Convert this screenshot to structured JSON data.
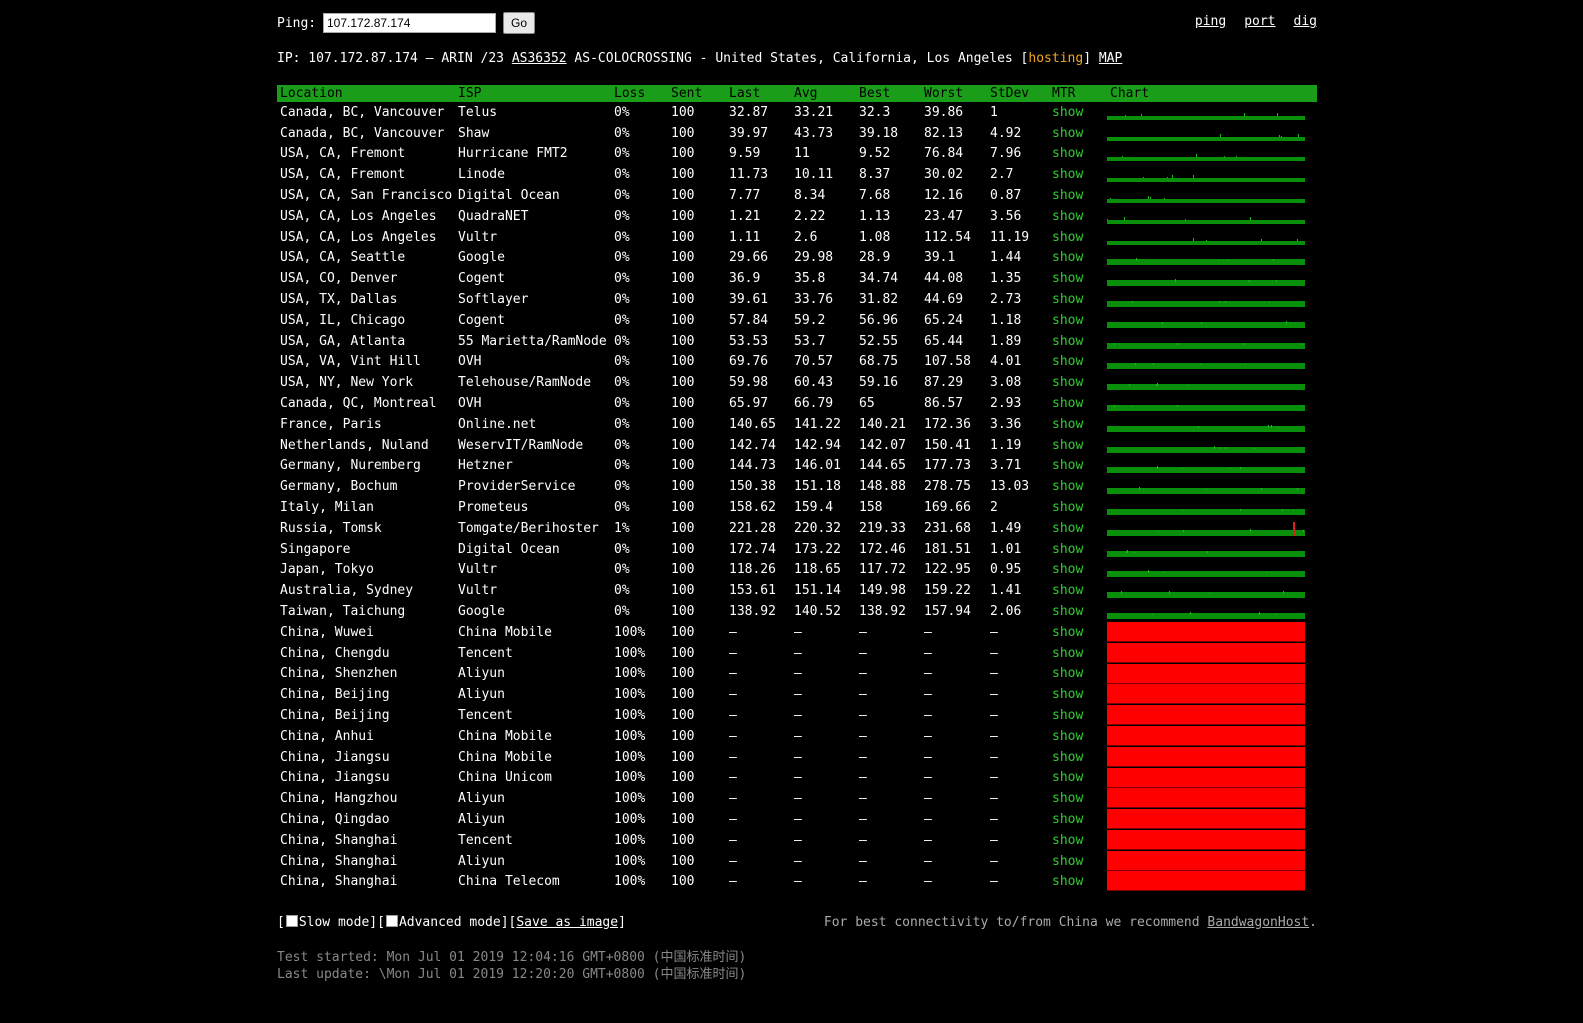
{
  "ping": {
    "label": "Ping:",
    "input_value": "107.172.87.174",
    "go_label": "Go"
  },
  "nav": {
    "ping": "ping",
    "port": "port",
    "dig": "dig"
  },
  "ipinfo": {
    "prefix": "IP: 107.172.87.174 – ARIN /23 ",
    "asn": "AS36352",
    "mid": " AS-COLOCROSSING - United States, California, Los Angeles [",
    "hosting": "hosting",
    "close": "] ",
    "map": "MAP"
  },
  "columns": [
    "Location",
    "ISP",
    "Loss",
    "Sent",
    "Last",
    "Avg",
    "Best",
    "Worst",
    "StDev",
    "MTR",
    "Chart"
  ],
  "rows": [
    [
      "Canada, BC, Vancouver",
      "Telus",
      "0%",
      "100",
      "32.87",
      "33.21",
      "32.3",
      "39.86",
      "1",
      "show"
    ],
    [
      "Canada, BC, Vancouver",
      "Shaw",
      "0%",
      "100",
      "39.97",
      "43.73",
      "39.18",
      "82.13",
      "4.92",
      "show"
    ],
    [
      "USA, CA, Fremont",
      "Hurricane FMT2",
      "0%",
      "100",
      "9.59",
      "11",
      "9.52",
      "76.84",
      "7.96",
      "show"
    ],
    [
      "USA, CA, Fremont",
      "Linode",
      "0%",
      "100",
      "11.73",
      "10.11",
      "8.37",
      "30.02",
      "2.7",
      "show"
    ],
    [
      "USA, CA, San Francisco",
      "Digital Ocean",
      "0%",
      "100",
      "7.77",
      "8.34",
      "7.68",
      "12.16",
      "0.87",
      "show"
    ],
    [
      "USA, CA, Los Angeles",
      "QuadraNET",
      "0%",
      "100",
      "1.21",
      "2.22",
      "1.13",
      "23.47",
      "3.56",
      "show"
    ],
    [
      "USA, CA, Los Angeles",
      "Vultr",
      "0%",
      "100",
      "1.11",
      "2.6",
      "1.08",
      "112.54",
      "11.19",
      "show"
    ],
    [
      "USA, CA, Seattle",
      "Google",
      "0%",
      "100",
      "29.66",
      "29.98",
      "28.9",
      "39.1",
      "1.44",
      "show"
    ],
    [
      "USA, CO, Denver",
      "Cogent",
      "0%",
      "100",
      "36.9",
      "35.8",
      "34.74",
      "44.08",
      "1.35",
      "show"
    ],
    [
      "USA, TX, Dallas",
      "Softlayer",
      "0%",
      "100",
      "39.61",
      "33.76",
      "31.82",
      "44.69",
      "2.73",
      "show"
    ],
    [
      "USA, IL, Chicago",
      "Cogent",
      "0%",
      "100",
      "57.84",
      "59.2",
      "56.96",
      "65.24",
      "1.18",
      "show"
    ],
    [
      "USA, GA, Atlanta",
      "55 Marietta/RamNode",
      "0%",
      "100",
      "53.53",
      "53.7",
      "52.55",
      "65.44",
      "1.89",
      "show"
    ],
    [
      "USA, VA, Vint Hill",
      "OVH",
      "0%",
      "100",
      "69.76",
      "70.57",
      "68.75",
      "107.58",
      "4.01",
      "show"
    ],
    [
      "USA, NY, New York",
      "Telehouse/RamNode",
      "0%",
      "100",
      "59.98",
      "60.43",
      "59.16",
      "87.29",
      "3.08",
      "show"
    ],
    [
      "Canada, QC, Montreal",
      "OVH",
      "0%",
      "100",
      "65.97",
      "66.79",
      "65",
      "86.57",
      "2.93",
      "show"
    ],
    [
      "France, Paris",
      "Online.net",
      "0%",
      "100",
      "140.65",
      "141.22",
      "140.21",
      "172.36",
      "3.36",
      "show"
    ],
    [
      "Netherlands, Nuland",
      "WeservIT/RamNode",
      "0%",
      "100",
      "142.74",
      "142.94",
      "142.07",
      "150.41",
      "1.19",
      "show"
    ],
    [
      "Germany, Nuremberg",
      "Hetzner",
      "0%",
      "100",
      "144.73",
      "146.01",
      "144.65",
      "177.73",
      "3.71",
      "show"
    ],
    [
      "Germany, Bochum",
      "ProviderService",
      "0%",
      "100",
      "150.38",
      "151.18",
      "148.88",
      "278.75",
      "13.03",
      "show"
    ],
    [
      "Italy, Milan",
      "Prometeus",
      "0%",
      "100",
      "158.62",
      "159.4",
      "158",
      "169.66",
      "2",
      "show"
    ],
    [
      "Russia, Tomsk",
      "Tomgate/Berihoster",
      "1%",
      "100",
      "221.28",
      "220.32",
      "219.33",
      "231.68",
      "1.49",
      "show"
    ],
    [
      "Singapore",
      "Digital Ocean",
      "0%",
      "100",
      "172.74",
      "173.22",
      "172.46",
      "181.51",
      "1.01",
      "show"
    ],
    [
      "Japan, Tokyo",
      "Vultr",
      "0%",
      "100",
      "118.26",
      "118.65",
      "117.72",
      "122.95",
      "0.95",
      "show"
    ],
    [
      "Australia, Sydney",
      "Vultr",
      "0%",
      "100",
      "153.61",
      "151.14",
      "149.98",
      "159.22",
      "1.41",
      "show"
    ],
    [
      "Taiwan, Taichung",
      "Google",
      "0%",
      "100",
      "138.92",
      "140.52",
      "138.92",
      "157.94",
      "2.06",
      "show"
    ],
    [
      "China, Wuwei",
      "China Mobile",
      "100%",
      "100",
      "–",
      "–",
      "–",
      "–",
      "–",
      "show"
    ],
    [
      "China, Chengdu",
      "Tencent",
      "100%",
      "100",
      "–",
      "–",
      "–",
      "–",
      "–",
      "show"
    ],
    [
      "China, Shenzhen",
      "Aliyun",
      "100%",
      "100",
      "–",
      "–",
      "–",
      "–",
      "–",
      "show"
    ],
    [
      "China, Beijing",
      "Aliyun",
      "100%",
      "100",
      "–",
      "–",
      "–",
      "–",
      "–",
      "show"
    ],
    [
      "China, Beijing",
      "Tencent",
      "100%",
      "100",
      "–",
      "–",
      "–",
      "–",
      "–",
      "show"
    ],
    [
      "China, Anhui",
      "China Mobile",
      "100%",
      "100",
      "–",
      "–",
      "–",
      "–",
      "–",
      "show"
    ],
    [
      "China, Jiangsu",
      "China Mobile",
      "100%",
      "100",
      "–",
      "–",
      "–",
      "–",
      "–",
      "show"
    ],
    [
      "China, Jiangsu",
      "China Unicom",
      "100%",
      "100",
      "–",
      "–",
      "–",
      "–",
      "–",
      "show"
    ],
    [
      "China, Hangzhou",
      "Aliyun",
      "100%",
      "100",
      "–",
      "–",
      "–",
      "–",
      "–",
      "show"
    ],
    [
      "China, Qingdao",
      "Aliyun",
      "100%",
      "100",
      "–",
      "–",
      "–",
      "–",
      "–",
      "show"
    ],
    [
      "China, Shanghai",
      "Tencent",
      "100%",
      "100",
      "–",
      "–",
      "–",
      "–",
      "–",
      "show"
    ],
    [
      "China, Shanghai",
      "Aliyun",
      "100%",
      "100",
      "–",
      "–",
      "–",
      "–",
      "–",
      "show"
    ],
    [
      "China, Shanghai",
      "China Telecom",
      "100%",
      "100",
      "–",
      "–",
      "–",
      "–",
      "–",
      "show"
    ]
  ],
  "colors": {
    "header_green": "#1a9e1a",
    "ok_bar": "#0a8f0a",
    "dead_bar": "#ff0000",
    "hosting": "#f5a623",
    "mtr_link": "#33cc33"
  },
  "footer": {
    "bracket_open": "[",
    "slow_mode": "Slow mode",
    "sep": "][",
    "advanced_mode": "Advanced mode",
    "save_image": "Save as image",
    "bracket_close": "]",
    "recommend_prefix": "For best connectivity to/from China we recommend ",
    "recommend_link": "BandwagonHost",
    "recommend_suffix": "."
  },
  "times": {
    "started": "Test started: Mon Jul 01 2019 12:04:16 GMT+0800 (中国标准时间)",
    "updated": "Last update: \\Mon Jul 01 2019 12:20:20 GMT+0800 (中国标准时间)"
  }
}
